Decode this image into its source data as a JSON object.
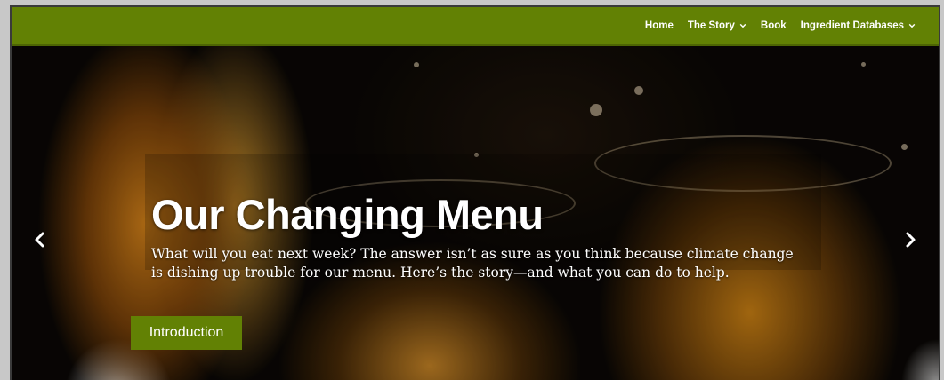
{
  "nav": {
    "items": [
      {
        "label": "Home",
        "has_dropdown": false
      },
      {
        "label": "The Story",
        "has_dropdown": true
      },
      {
        "label": "Book",
        "has_dropdown": false
      },
      {
        "label": "Ingredient Databases",
        "has_dropdown": true
      }
    ],
    "bg_color": "#628104"
  },
  "slider": {
    "title": "Our Changing Menu",
    "text": "What will you eat next week? The answer isn’t as sure as you think because climate change is dishing up trouble for our menu. Here’s the story—and what you can do to help.",
    "button_label": "Introduction",
    "prev_icon": "chevron-left-icon",
    "next_icon": "chevron-right-icon",
    "accent_color": "#628104"
  }
}
